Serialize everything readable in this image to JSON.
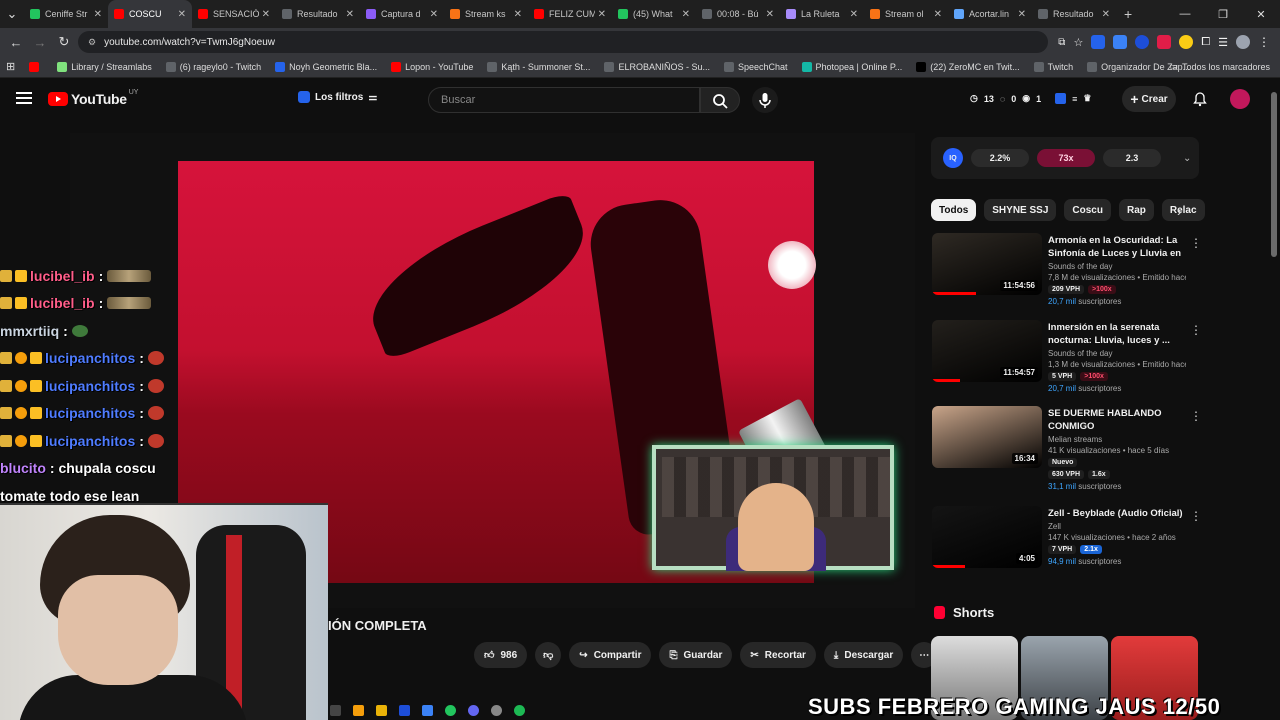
{
  "browser": {
    "tabs": [
      {
        "title": "Ceniffe Str",
        "color": "#22c55e",
        "active": false
      },
      {
        "title": "COSCU",
        "color": "#ff0000",
        "active": true
      },
      {
        "title": "SENSACIÓ",
        "color": "#ff0000",
        "active": false
      },
      {
        "title": "Resultado",
        "color": "#5f6368",
        "active": false
      },
      {
        "title": "Captura d",
        "color": "#8b5cf6",
        "active": false
      },
      {
        "title": "Stream ks",
        "color": "#f97316",
        "active": false
      },
      {
        "title": "FELIZ CUM",
        "color": "#ff0000",
        "active": false
      },
      {
        "title": "(45) What",
        "color": "#22c55e",
        "active": false
      },
      {
        "title": "00:08 - Bú",
        "color": "#5f6368",
        "active": false
      },
      {
        "title": "La Ruleta",
        "color": "#a78bfa",
        "active": false
      },
      {
        "title": "Stream ol",
        "color": "#f97316",
        "active": false
      },
      {
        "title": "Acortar.lin",
        "color": "#60a5fa",
        "active": false
      },
      {
        "title": "Resultado",
        "color": "#5f6368",
        "active": false
      }
    ],
    "url": "youtube.com/watch?v=TwmJ6gNoeuw",
    "bookmarks": [
      {
        "label": "Library / Streamlabs",
        "color": "#80e27e"
      },
      {
        "label": "(6) rageylo0 - Twitch",
        "color": "#5f6368"
      },
      {
        "label": "Noyh Geometric Bla...",
        "color": "#2563eb"
      },
      {
        "label": "Lopon - YouTube",
        "color": "#ff0000"
      },
      {
        "label": "Kąth - Summoner St...",
        "color": "#5f6368"
      },
      {
        "label": "ELROBANIÑOS - Su...",
        "color": "#5f6368"
      },
      {
        "label": "SpeechChat",
        "color": "#5f6368"
      },
      {
        "label": "Photopea | Online P...",
        "color": "#14b8a6"
      },
      {
        "label": "(22) ZeroMC en Twit...",
        "color": "#000000"
      },
      {
        "label": "Twitch",
        "color": "#5f6368"
      },
      {
        "label": "Organizador De Zap...",
        "color": "#5f6368"
      }
    ],
    "all_bookmarks": "Todos los marcadores"
  },
  "youtube": {
    "logo_text": "YouTube",
    "region": "UY",
    "filters_label": "Los filtros",
    "search_placeholder": "Buscar",
    "stats": {
      "a": "13",
      "b": "0",
      "c": "1"
    },
    "create_label": "Crear",
    "video_title_fragment": "IÓN COMPLETA",
    "actions": {
      "likes": "986",
      "share": "Compartir",
      "save": "Guardar",
      "clip": "Recortar",
      "download": "Descargar"
    }
  },
  "chat": [
    {
      "user": "lucibel_ib",
      "text": ":",
      "color": "#ff5e8a",
      "emote": "big"
    },
    {
      "user": "lucibel_ib",
      "text": ":",
      "color": "#ff5e8a",
      "emote": "big"
    },
    {
      "user": "mmxrtiiq",
      "text": ":",
      "color": "#cbd5e1",
      "emote": "small"
    },
    {
      "user": "lucipanchitos",
      "text": ":",
      "color": "#4f7cff",
      "emote": "red"
    },
    {
      "user": "lucipanchitos",
      "text": ":",
      "color": "#4f7cff",
      "emote": "red"
    },
    {
      "user": "lucipanchitos",
      "text": ":",
      "color": "#4f7cff",
      "emote": "red"
    },
    {
      "user": "lucipanchitos",
      "text": ":",
      "color": "#4f7cff",
      "emote": "red"
    },
    {
      "user": "blucito",
      "text": ": chupala coscu",
      "color": "#c084fc",
      "emote": "none"
    },
    {
      "user": "",
      "text": "tomate todo ese lean",
      "color": "#ffffff",
      "emote": "none"
    }
  ],
  "sidebar": {
    "metrics": [
      "2.2%",
      "73x",
      "2.3"
    ],
    "chips": [
      "Todos",
      "SHYNE SSJ",
      "Coscu",
      "Rap",
      "Relac"
    ],
    "recs": [
      {
        "title": "Armonía en la Oscuridad: La Sinfonía de Luces y Lluvia en l...",
        "channel": "Sounds of the day",
        "views": "7,8 M de visualizaciones • Emitido hace ...",
        "duration": "11:54:56",
        "vph": "209 VPH",
        "badge": ">100x",
        "badge_style": "red",
        "subs": "20,7 mil",
        "subs_label": "suscriptores",
        "progress": 0.4,
        "thumb": "#2f2a24"
      },
      {
        "title": "Inmersión en la serenata nocturna: Lluvia, luces y ...",
        "channel": "Sounds of the day",
        "views": "1,3 M de visualizaciones • Emitido hace ...",
        "duration": "11:54:57",
        "vph": "5 VPH",
        "badge": ">100x",
        "badge_style": "red",
        "subs": "20,7 mil",
        "subs_label": "suscriptores",
        "progress": 0.25,
        "thumb": "#23201c"
      },
      {
        "title": "SE DUERME HABLANDO CONMIGO",
        "channel": "Melian streams",
        "views": "41 K visualizaciones • hace 5 días",
        "duration": "16:34",
        "vph": "630 VPH",
        "badge": "1.6x",
        "badge_style": "plain",
        "subs": "31,1 mil",
        "subs_label": "suscriptores",
        "progress": 0.0,
        "thumb": "#c9a58a",
        "extra": "Nuevo"
      },
      {
        "title": "Zell - Beyblade (Audio Oficial)",
        "channel": "Zell",
        "views": "147 K visualizaciones • hace 2 años",
        "duration": "4:05",
        "vph": "7 VPH",
        "badge": "2.1x",
        "badge_style": "blue",
        "subs": "94,9 mil",
        "subs_label": "suscriptores",
        "progress": 0.3,
        "thumb": "#141414"
      }
    ],
    "shorts_label": "Shorts"
  },
  "overlay": {
    "subs_banner": "SUBS FEBRERO GAMING JAUS",
    "subs_count": "12/50"
  },
  "colors": {
    "accent": "#ff0000",
    "bg": "#0f0f0f",
    "scene": "#d6133b"
  }
}
